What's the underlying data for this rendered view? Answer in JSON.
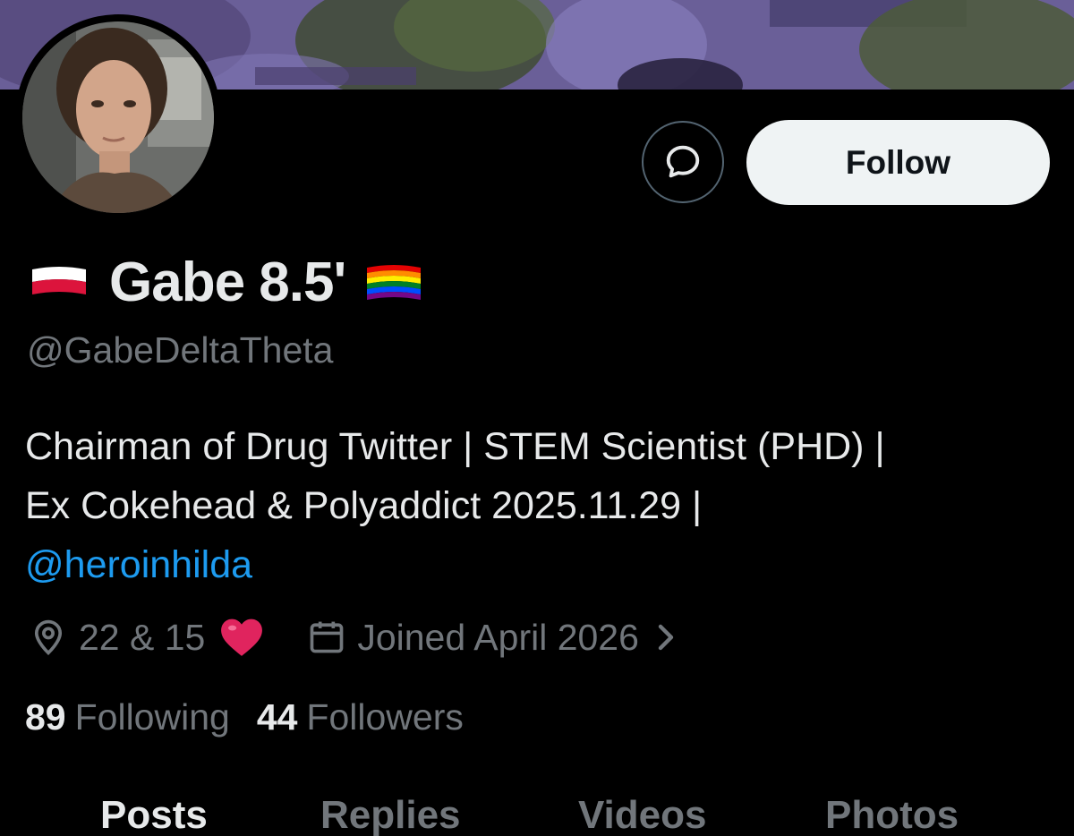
{
  "profile": {
    "display_name": "Gabe 8.5'",
    "handle": "@GabeDeltaTheta",
    "name_flag_left": "poland-flag-icon",
    "name_flag_right": "rainbow-flag-icon"
  },
  "actions": {
    "message_icon": "message-bubble-icon",
    "follow_label": "Follow"
  },
  "bio": {
    "line1": "Chairman of Drug Twitter | STEM Scientist (PHD) |",
    "line2": "Ex Cokehead & Polyaddict 2025.11.29 |",
    "mention": "@heroinhilda"
  },
  "meta": {
    "location": "22 & 15",
    "location_icon": "location-pin-icon",
    "location_emoji": "red-heart-icon",
    "joined": "Joined April 2026",
    "joined_icon": "calendar-icon"
  },
  "stats": {
    "following_count": "89",
    "following_label": "Following",
    "followers_count": "44",
    "followers_label": "Followers"
  },
  "tabs": [
    {
      "label": "Posts"
    },
    {
      "label": "Replies"
    },
    {
      "label": "Videos"
    },
    {
      "label": "Photos"
    }
  ],
  "colors": {
    "background": "#000000",
    "text_primary": "#e7e9ea",
    "text_secondary": "#71767b",
    "link": "#1d9bf0",
    "follow_button_bg": "#eff3f4",
    "heart": "#e0245e"
  }
}
